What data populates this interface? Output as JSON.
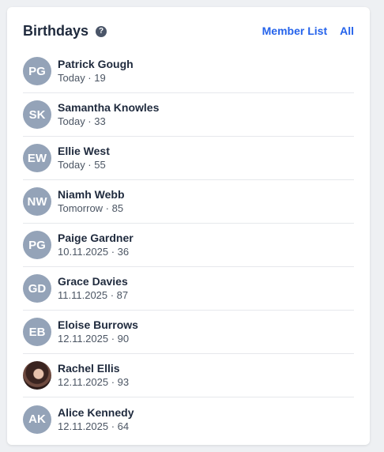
{
  "header": {
    "title": "Birthdays",
    "help_icon": "help-circle-icon",
    "member_list_label": "Member List",
    "all_label": "All"
  },
  "colors": {
    "link": "#2563eb",
    "avatar_bg": "#94a3b8"
  },
  "birthdays": [
    {
      "initials": "PG",
      "name": "Patrick Gough",
      "meta": "Today · 19"
    },
    {
      "initials": "SK",
      "name": "Samantha Knowles",
      "meta": "Today · 33"
    },
    {
      "initials": "EW",
      "name": "Ellie West",
      "meta": "Today · 55"
    },
    {
      "initials": "NW",
      "name": "Niamh Webb",
      "meta": "Tomorrow · 85"
    },
    {
      "initials": "PG",
      "name": "Paige Gardner",
      "meta": "10.11.2025 · 36"
    },
    {
      "initials": "GD",
      "name": "Grace Davies",
      "meta": "11.11.2025 · 87"
    },
    {
      "initials": "EB",
      "name": "Eloise Burrows",
      "meta": "12.11.2025 · 90"
    },
    {
      "initials": "",
      "name": "Rachel Ellis",
      "meta": "12.11.2025 · 93",
      "photo": true
    },
    {
      "initials": "AK",
      "name": "Alice Kennedy",
      "meta": "12.11.2025 · 64"
    }
  ]
}
